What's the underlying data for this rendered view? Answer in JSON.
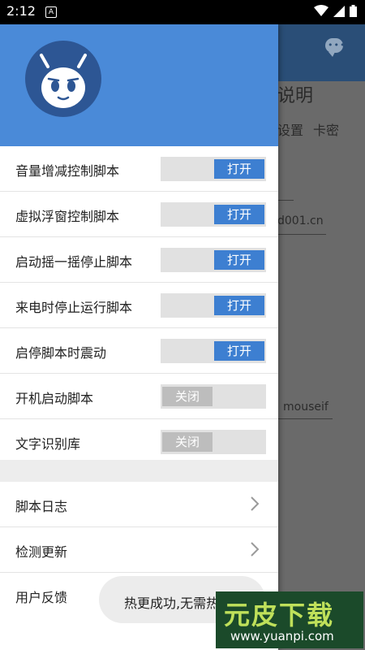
{
  "status_bar": {
    "time": "2:12",
    "notification_letter": "A"
  },
  "background": {
    "title": "说明",
    "tabs": [
      "设置",
      "卡密"
    ],
    "url_field": "d001.cn",
    "user_field": "mouseif"
  },
  "drawer": {
    "toggle_items": [
      {
        "label": "音量增减控制脚本",
        "state": "打开"
      },
      {
        "label": "虚拟浮窗控制脚本",
        "state": "打开"
      },
      {
        "label": "启动摇一摇停止脚本",
        "state": "打开"
      },
      {
        "label": "来电时停止运行脚本",
        "state": "打开"
      },
      {
        "label": "启停脚本时震动",
        "state": "打开"
      },
      {
        "label": "开机启动脚本",
        "state": "关闭"
      },
      {
        "label": "文字识别库",
        "state": "关闭"
      }
    ],
    "menu_items": [
      {
        "label": "脚本日志"
      },
      {
        "label": "检测更新"
      },
      {
        "label": "用户反馈"
      }
    ]
  },
  "toast": {
    "message": "热更成功,无需热更"
  },
  "watermark": {
    "title": "元皮下载",
    "url": "www.yuanpi.com"
  },
  "colors": {
    "drawer_header": "#4a8ad8",
    "toggle_on": "#3d7fd1",
    "toggle_off": "#bdbdbd",
    "app_bar": "#2a4e77"
  }
}
